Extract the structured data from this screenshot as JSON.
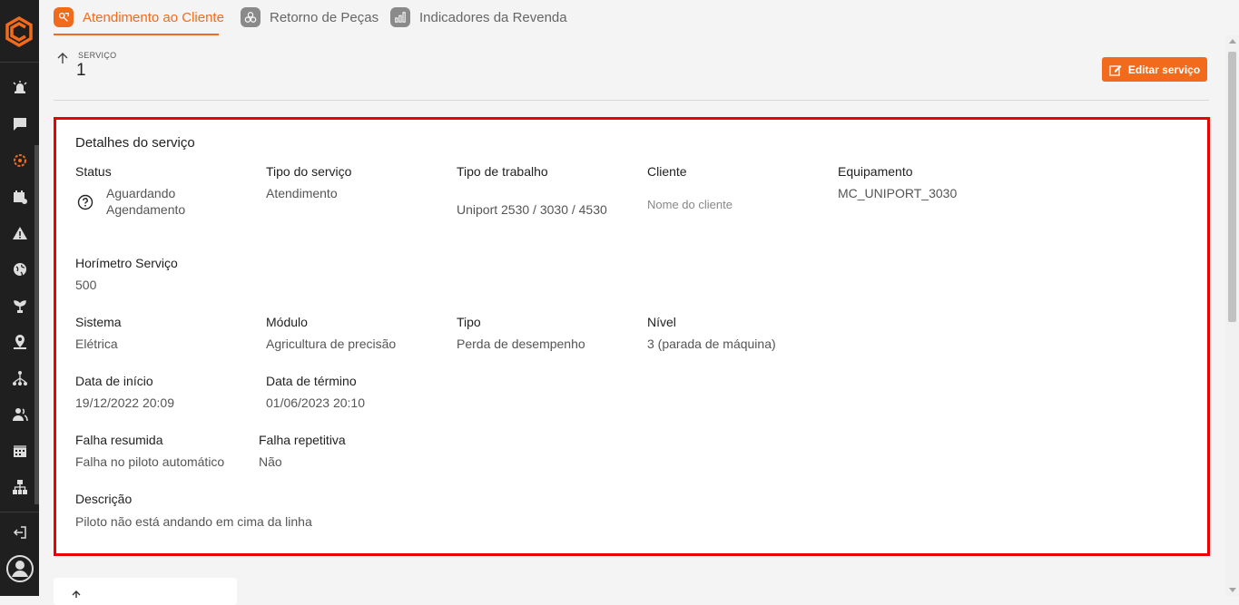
{
  "tabs": [
    {
      "label": "Atendimento ao Cliente",
      "icon": "service-icon",
      "active": true
    },
    {
      "label": "Retorno de Peças",
      "icon": "parts-icon",
      "active": false
    },
    {
      "label": "Indicadores da Revenda",
      "icon": "chart-icon",
      "active": false
    }
  ],
  "header": {
    "label": "SERVIÇO",
    "number": "1",
    "edit_button": "Editar serviço"
  },
  "details": {
    "title": "Detalhes do serviço",
    "status_label": "Status",
    "status_value": "Aguardando Agendamento",
    "tipo_servico_label": "Tipo do serviço",
    "tipo_servico_value": "Atendimento",
    "tipo_trabalho_label": "Tipo de trabalho",
    "tipo_trabalho_value": "Uniport 2530 / 3030 / 4530",
    "cliente_label": "Cliente",
    "cliente_value": "Nome do cliente",
    "equipamento_label": "Equipamento",
    "equipamento_value": "MC_UNIPORT_3030",
    "horimetro_label": "Horímetro Serviço",
    "horimetro_value": "500",
    "sistema_label": "Sistema",
    "sistema_value": "Elétrica",
    "modulo_label": "Módulo",
    "modulo_value": "Agricultura de precisão",
    "tipo_label": "Tipo",
    "tipo_value": "Perda de desempenho",
    "nivel_label": "Nível",
    "nivel_value": "3 (parada de máquina)",
    "data_inicio_label": "Data de início",
    "data_inicio_value": "19/12/2022 20:09",
    "data_termino_label": "Data de término",
    "data_termino_value": "01/06/2023 20:10",
    "falha_resumida_label": "Falha resumida",
    "falha_resumida_value": "Falha no piloto automático",
    "falha_repetitiva_label": "Falha repetitiva",
    "falha_repetitiva_value": "Não",
    "descricao_label": "Descrição",
    "descricao_value": "Piloto não está andando em cima da linha"
  },
  "colors": {
    "accent": "#f26b1d",
    "sidebar": "#1f1f1f",
    "highlight_border": "#ee0000"
  }
}
